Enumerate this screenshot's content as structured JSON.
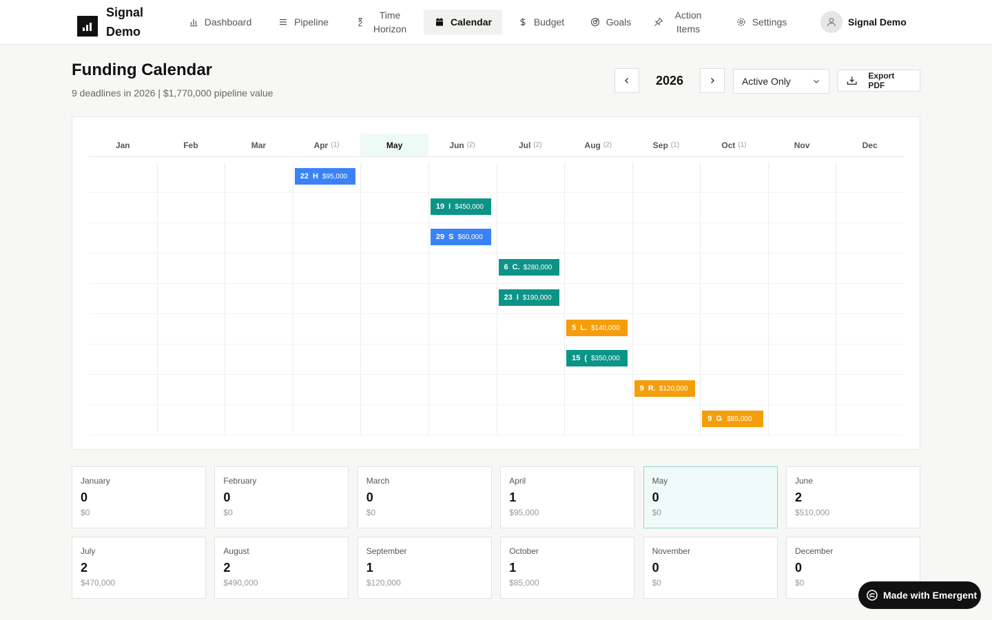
{
  "app": {
    "name": "Signal Demo"
  },
  "nav": [
    {
      "id": "dashboard",
      "label": "Dashboard",
      "icon": "bar-chart-icon",
      "active": false
    },
    {
      "id": "pipeline",
      "label": "Pipeline",
      "icon": "list-icon",
      "active": false
    },
    {
      "id": "time-horizon",
      "label": "Time Horizon",
      "icon": "hourglass-icon",
      "active": false
    },
    {
      "id": "calendar",
      "label": "Calendar",
      "icon": "calendar-icon",
      "active": true
    },
    {
      "id": "budget",
      "label": "Budget",
      "icon": "dollar-icon",
      "active": false
    },
    {
      "id": "goals",
      "label": "Goals",
      "icon": "target-icon",
      "active": false
    },
    {
      "id": "action-items",
      "label": "Action Items",
      "icon": "pin-icon",
      "active": false
    },
    {
      "id": "settings",
      "label": "Settings",
      "icon": "gear-icon",
      "active": false
    }
  ],
  "user": {
    "name": "Signal Demo"
  },
  "header": {
    "title": "Funding Calendar",
    "subtitle": "9 deadlines in 2026 | $1,770,000 pipeline value",
    "year": "2026",
    "filter": "Active Only",
    "export_label": "Export PDF"
  },
  "months": [
    {
      "short": "Jan",
      "count": "",
      "current": false
    },
    {
      "short": "Feb",
      "count": "",
      "current": false
    },
    {
      "short": "Mar",
      "count": "",
      "current": false
    },
    {
      "short": "Apr",
      "count": "(1)",
      "current": false
    },
    {
      "short": "May",
      "count": "",
      "current": true
    },
    {
      "short": "Jun",
      "count": "(2)",
      "current": false
    },
    {
      "short": "Jul",
      "count": "(2)",
      "current": false
    },
    {
      "short": "Aug",
      "count": "(2)",
      "current": false
    },
    {
      "short": "Sep",
      "count": "(1)",
      "current": false
    },
    {
      "short": "Oct",
      "count": "(1)",
      "current": false
    },
    {
      "short": "Nov",
      "count": "",
      "current": false
    },
    {
      "short": "Dec",
      "count": "",
      "current": false
    }
  ],
  "events": [
    {
      "month": 4,
      "day": "22",
      "name": "H",
      "amount": "$95,000",
      "color": "#3b82f6"
    },
    {
      "month": 6,
      "day": "19",
      "name": "I",
      "amount": "$450,000",
      "color": "#0d9488"
    },
    {
      "month": 6,
      "day": "29",
      "name": "S",
      "amount": "$60,000",
      "color": "#3b82f6"
    },
    {
      "month": 7,
      "day": "6",
      "name": "C.",
      "amount": "$280,000",
      "color": "#0d9488"
    },
    {
      "month": 7,
      "day": "23",
      "name": "I",
      "amount": "$190,000",
      "color": "#0d9488"
    },
    {
      "month": 8,
      "day": "5",
      "name": "L.",
      "amount": "$140,000",
      "color": "#f59e0b"
    },
    {
      "month": 8,
      "day": "15",
      "name": "(",
      "amount": "$350,000",
      "color": "#0d9488"
    },
    {
      "month": 9,
      "day": "9",
      "name": "R.",
      "amount": "$120,000",
      "color": "#f59e0b"
    },
    {
      "month": 10,
      "day": "9",
      "name": "G..",
      "amount": "$85,000",
      "color": "#f59e0b"
    }
  ],
  "cards": [
    {
      "month": "January",
      "count": "0",
      "value": "$0",
      "current": false
    },
    {
      "month": "February",
      "count": "0",
      "value": "$0",
      "current": false
    },
    {
      "month": "March",
      "count": "0",
      "value": "$0",
      "current": false
    },
    {
      "month": "April",
      "count": "1",
      "value": "$95,000",
      "current": false
    },
    {
      "month": "May",
      "count": "0",
      "value": "$0",
      "current": true
    },
    {
      "month": "June",
      "count": "2",
      "value": "$510,000",
      "current": false
    },
    {
      "month": "July",
      "count": "2",
      "value": "$470,000",
      "current": false
    },
    {
      "month": "August",
      "count": "2",
      "value": "$490,000",
      "current": false
    },
    {
      "month": "September",
      "count": "1",
      "value": "$120,000",
      "current": false
    },
    {
      "month": "October",
      "count": "1",
      "value": "$85,000",
      "current": false
    },
    {
      "month": "November",
      "count": "0",
      "value": "$0",
      "current": false
    },
    {
      "month": "December",
      "count": "0",
      "value": "$0",
      "current": false
    }
  ],
  "badge": {
    "label": "Made with Emergent"
  }
}
